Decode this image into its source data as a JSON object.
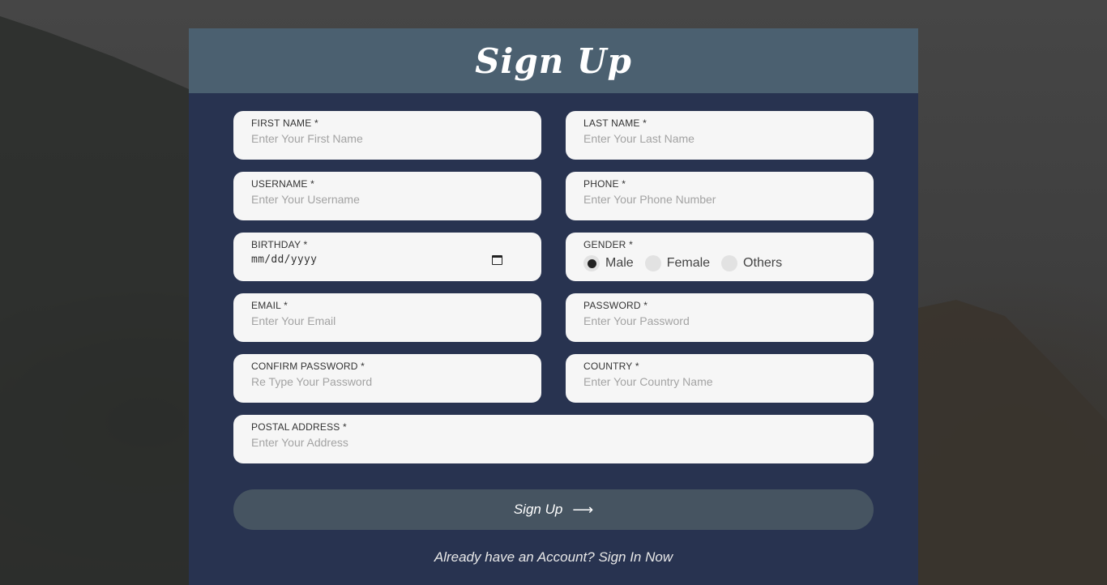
{
  "form": {
    "title": "Sign Up",
    "fields": {
      "first_name": {
        "label": "FIRST NAME *",
        "placeholder": "Enter Your First Name"
      },
      "last_name": {
        "label": "LAST NAME *",
        "placeholder": "Enter Your Last Name"
      },
      "username": {
        "label": "USERNAME *",
        "placeholder": "Enter Your Username"
      },
      "phone": {
        "label": "PHONE *",
        "placeholder": "Enter Your Phone Number"
      },
      "birthday": {
        "label": "BIRTHDAY *",
        "value": "mm/dd/yyyy"
      },
      "gender": {
        "label": "GENDER *",
        "options": [
          "Male",
          "Female",
          "Others"
        ],
        "selected": "Male"
      },
      "email": {
        "label": "EMAIL *",
        "placeholder": "Enter Your Email"
      },
      "password": {
        "label": "PASSWORD *",
        "placeholder": "Enter Your Password"
      },
      "confirm_password": {
        "label": "CONFIRM PASSWORD *",
        "placeholder": "Re Type Your Password"
      },
      "country": {
        "label": "COUNTRY *",
        "placeholder": "Enter Your Country Name"
      },
      "postal_address": {
        "label": "POSTAL ADDRESS *",
        "placeholder": "Enter Your Address"
      }
    },
    "submit_label": "Sign Up",
    "submit_icon": "arrow-right-icon",
    "signin_prompt": "Already have an Account?",
    "signin_link": "Sign In Now"
  },
  "colors": {
    "card": "#283350",
    "header": "#4b6070",
    "field_bg": "#f6f6f6",
    "button": "#465461"
  }
}
